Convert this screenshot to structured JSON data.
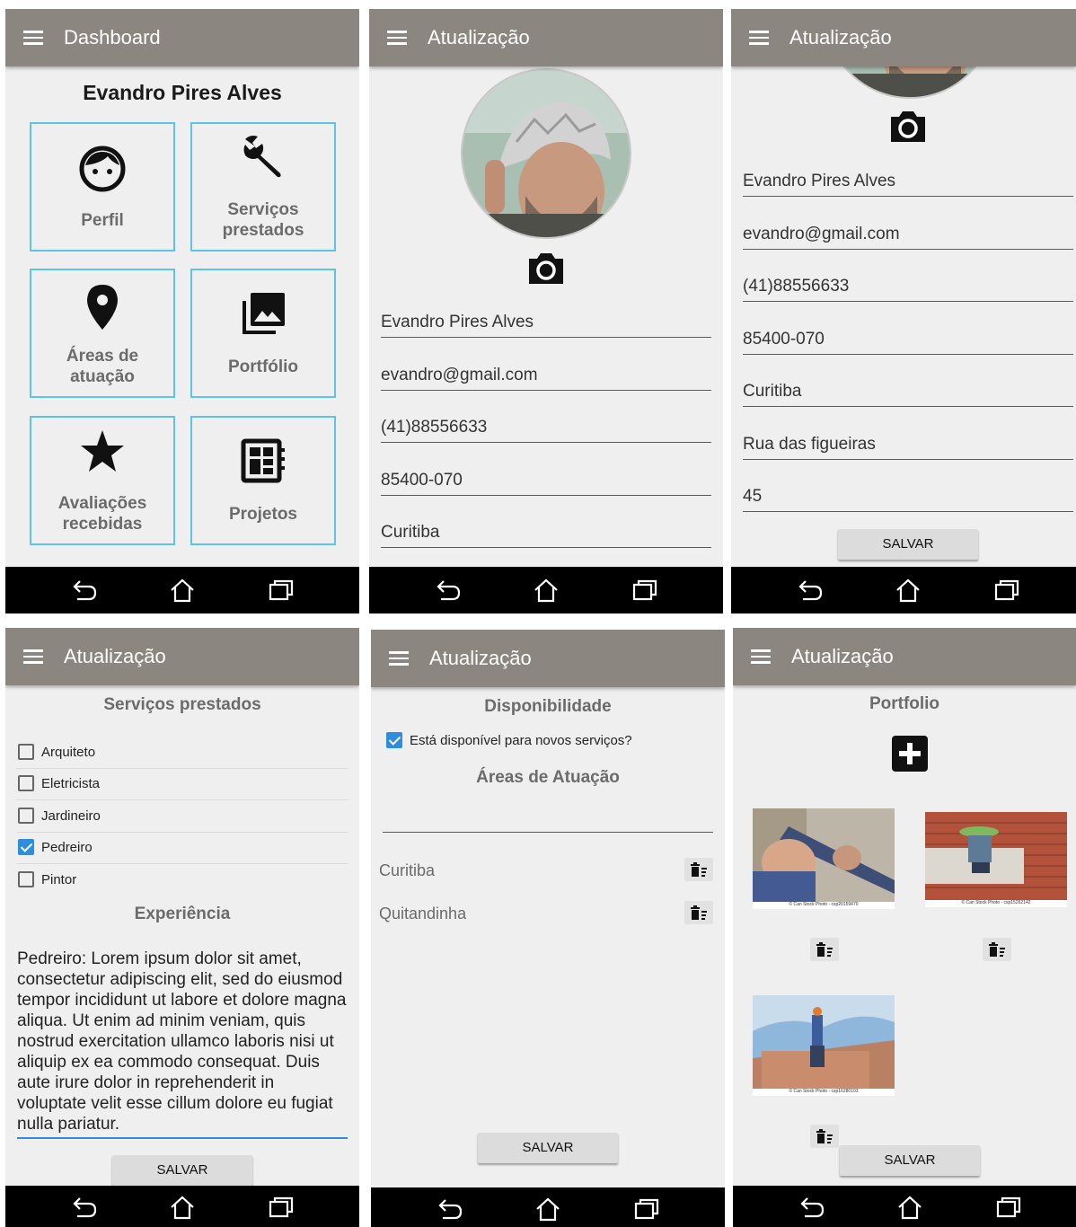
{
  "nav": {
    "back_icon": "back-icon",
    "home_icon": "home-icon",
    "recents_icon": "recents-icon"
  },
  "screen1": {
    "title": "Dashboard",
    "user_name": "Evandro Pires Alves",
    "tiles": [
      {
        "label_line1": "Perfil",
        "label_line2": "",
        "icon": "face-icon"
      },
      {
        "label_line1": "Serviços",
        "label_line2": "prestados",
        "icon": "wrench-icon"
      },
      {
        "label_line1": "Áreas de",
        "label_line2": "atuação",
        "icon": "location-pin-icon"
      },
      {
        "label_line1": "Portfólio",
        "label_line2": "",
        "icon": "photo-library-icon"
      },
      {
        "label_line1": "Avaliações",
        "label_line2": "recebidas",
        "icon": "star-icon"
      },
      {
        "label_line1": "Projetos",
        "label_line2": "",
        "icon": "projects-icon"
      }
    ]
  },
  "screen2": {
    "title": "Atualização",
    "fields": [
      "Evandro Pires Alves",
      "evandro@gmail.com",
      "(41)88556633",
      "85400-070",
      "Curitiba"
    ]
  },
  "screen3": {
    "title": "Atualização",
    "fields": [
      "Evandro Pires Alves",
      "evandro@gmail.com",
      "(41)88556633",
      "85400-070",
      "Curitiba",
      "Rua das figueiras",
      "45"
    ],
    "save_label": "SALVAR"
  },
  "screen4": {
    "title": "Atualização",
    "section_services": "Serviços prestados",
    "services": [
      {
        "label": "Arquiteto",
        "checked": false
      },
      {
        "label": "Eletricista",
        "checked": false
      },
      {
        "label": "Jardineiro",
        "checked": false
      },
      {
        "label": "Pedreiro",
        "checked": true
      },
      {
        "label": "Pintor",
        "checked": false
      }
    ],
    "section_experience": "Experiência",
    "experience_text": "Pedreiro: Lorem ipsum dolor sit amet, consectetur adipiscing elit, sed do eiusmod tempor incididunt ut labore et dolore magna aliqua. Ut enim ad minim veniam, quis nostrud exercitation ullamco laboris nisi ut aliquip ex ea commodo consequat. Duis aute irure dolor in reprehenderit in voluptate velit esse cillum dolore eu fugiat nulla pariatur.",
    "save_label": "SALVAR"
  },
  "screen5": {
    "title": "Atualização",
    "section_availability": "Disponibilidade",
    "available_label": "Está disponível para novos serviços?",
    "available_checked": true,
    "section_areas": "Áreas de Atuação",
    "area_input_value": "",
    "areas": [
      "Curitiba",
      "Quitandinha"
    ],
    "save_label": "SALVAR"
  },
  "screen6": {
    "title": "Atualização",
    "section_portfolio": "Portfolio",
    "photo_captions": [
      "© Can Stock Photo - csp20159470",
      "© Can Stock Photo - csp15262142",
      "© Can Stock Photo - csp16280103"
    ],
    "save_label": "SALVAR"
  },
  "colors": {
    "appbar": "#8b8680",
    "tile_border": "#5bc3ee",
    "checkbox": "#2f8ddb",
    "background": "#efefef"
  }
}
